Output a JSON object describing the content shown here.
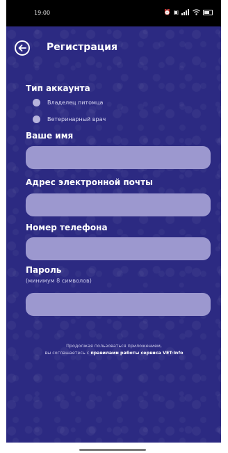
{
  "status_bar": {
    "time": "19:00",
    "icons": [
      "alarm-icon",
      "nfc-icon",
      "signal-icon",
      "wifi-icon",
      "battery-icon"
    ]
  },
  "header": {
    "back_icon": "arrow-left-circle-icon",
    "title": "Регистрация"
  },
  "form": {
    "account_type": {
      "label": "Тип аккаунта",
      "options": [
        {
          "label": "Владелец питомца",
          "selected": false
        },
        {
          "label": "Ветеринарный врач",
          "selected": false
        }
      ]
    },
    "name": {
      "label": "Ваше имя",
      "value": ""
    },
    "email": {
      "label": "Адрес электронной почты",
      "value": ""
    },
    "phone": {
      "label": "Номер телефона",
      "value": ""
    },
    "password": {
      "label": "Пароль",
      "hint": "(минимум 8 символов)",
      "value": ""
    }
  },
  "terms": {
    "line1": "Продолжая пользоваться приложением,",
    "line2_prefix": "вы соглашаетесь с",
    "link": "правилами работы сервиса VET-Info"
  },
  "colors": {
    "background": "#2c2a82",
    "field": "#9c98cf",
    "radio": "#b7b4dc",
    "text": "#ffffff"
  }
}
